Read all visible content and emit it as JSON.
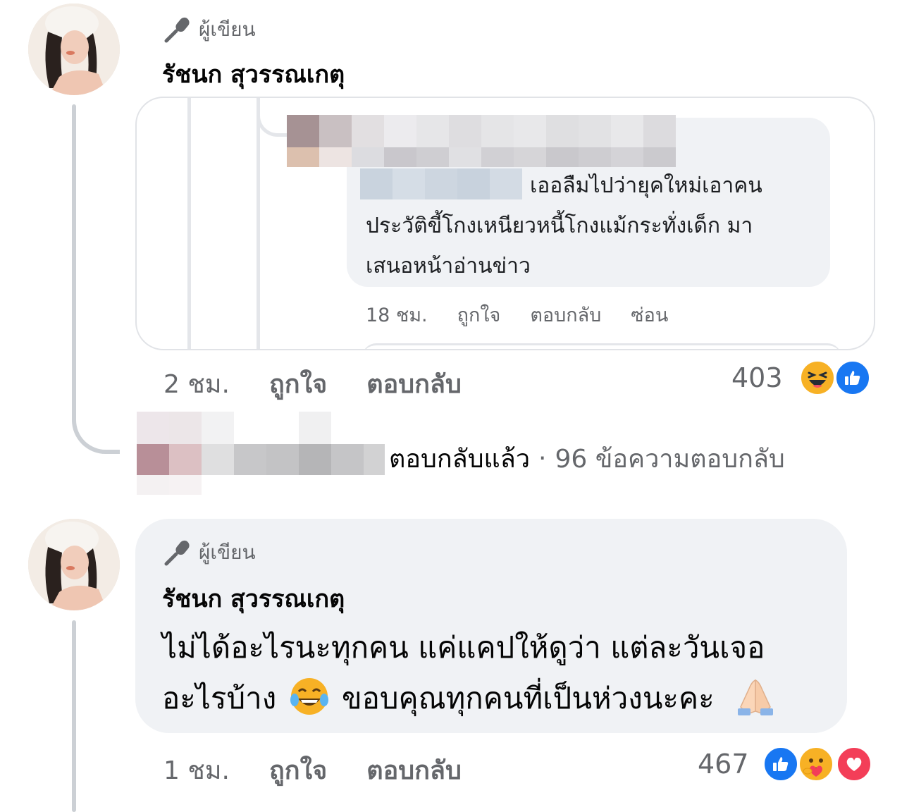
{
  "comment1": {
    "author_badge": "ผู้เขียน",
    "author_name": "รัชนก สุวรรณเกตุ",
    "embedded": {
      "text_line1": "เออลืมไปว่ายุคใหม่เอาคน",
      "text_line2": "ประวัติขี้โกงเหนียวหนี้โกงแม้กระทั่งเด็ก มา",
      "text_line3": "เสนอหน้าอ่านข่าว",
      "time": "18 ชม.",
      "like": "ถูกใจ",
      "reply": "ตอบกลับ",
      "hide": "ซ่อน"
    },
    "time": "2 ชม.",
    "like": "ถูกใจ",
    "reply": "ตอบกลับ",
    "reaction_count": "403",
    "reactions": [
      "haha-icon",
      "like-icon"
    ]
  },
  "replies_summary": {
    "replied_label": "ตอบกลับแล้ว",
    "separator": "·",
    "reply_count_text": "96 ข้อความตอบกลับ"
  },
  "comment2": {
    "author_badge": "ผู้เขียน",
    "author_name": "รัชนก สุวรรณเกตุ",
    "text_line1": "ไม่ได้อะไรนะทุกคน แค่แคปให้ดูว่า แต่ละวันเจอ",
    "text_line2_a": "อะไรบ้าง",
    "text_line2_b": "ขอบคุณทุกคนที่เป็นห่วงนะคะ",
    "time": "1 ชม.",
    "like": "ถูกใจ",
    "reply": "ตอบกลับ",
    "reaction_count": "467",
    "reactions": [
      "like-icon",
      "care-icon",
      "love-icon"
    ]
  },
  "colors": {
    "like_blue": "#1877f2",
    "haha_yellow": "#f7b125",
    "love_red": "#f33e58",
    "muted_text": "#65676b",
    "bubble_bg": "#f0f2f5"
  }
}
